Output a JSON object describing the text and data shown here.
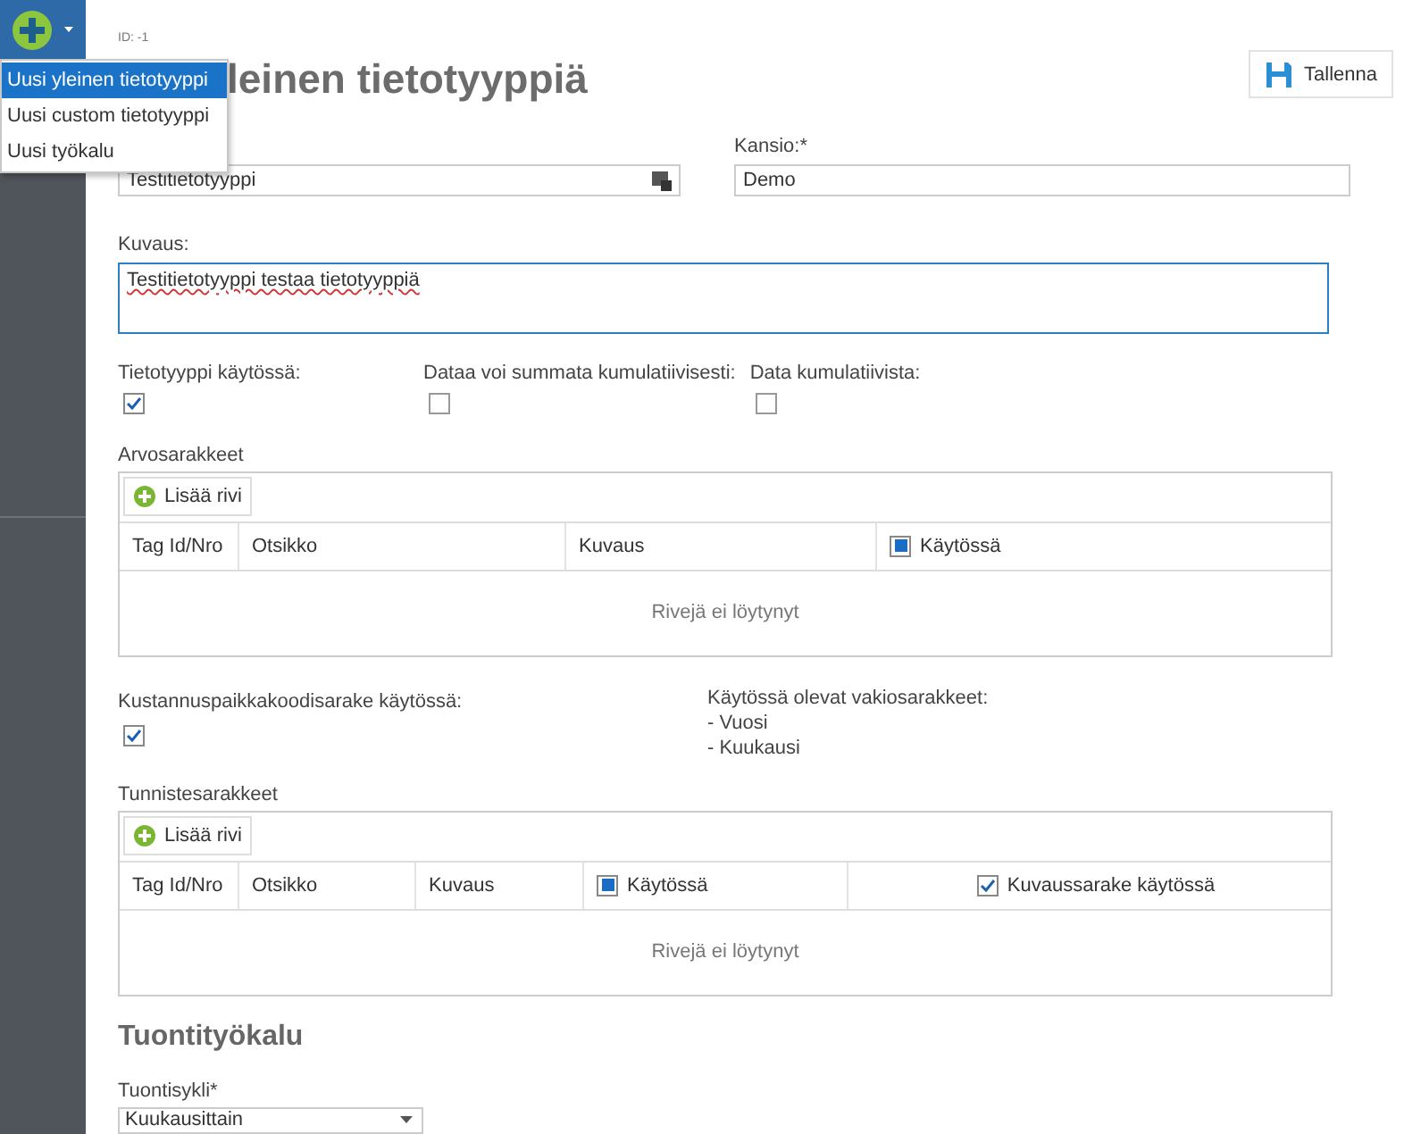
{
  "sidebar": {
    "menu": [
      {
        "label": "Uusi yleinen tietotyyppi",
        "selected": true
      },
      {
        "label": "Uusi custom tietotyyppi",
        "selected": false
      },
      {
        "label": "Uusi työkalu",
        "selected": false
      }
    ]
  },
  "header": {
    "id_text": "ID: -1",
    "title": "leinen tietotyyppiä",
    "save_button": "Tallenna"
  },
  "fields": {
    "name_value": "Testitietotyyppi",
    "folder_label": "Kansio:*",
    "folder_value": "Demo",
    "description_label": "Kuvaus:",
    "description_value": "Testitietotyyppi testaa tietotyyppiä"
  },
  "flags": [
    {
      "label": "Tietotyyppi käytössä:",
      "checked": true
    },
    {
      "label": "Dataa voi summata kumulatiivisesti:",
      "checked": false
    },
    {
      "label": "Data kumulatiivista:",
      "checked": false
    }
  ],
  "value_table": {
    "title": "Arvosarakkeet",
    "add_button": "Lisää rivi",
    "empty_text": "Rivejä ei löytynyt",
    "columns": [
      {
        "label": "Tag Id/Nro",
        "kind": "text"
      },
      {
        "label": "Otsikko",
        "kind": "text"
      },
      {
        "label": "Kuvaus",
        "kind": "text"
      },
      {
        "label": "Käytössä",
        "kind": "filled-checkbox",
        "checked": true
      }
    ]
  },
  "cost_center": {
    "label": "Kustannuspaikkakoodisarake käytössä:",
    "checked": true
  },
  "standard_columns": {
    "label": "Käytössä olevat vakiosarakkeet:",
    "items": [
      "- Vuosi",
      "- Kuukausi"
    ]
  },
  "id_table": {
    "title": "Tunnistesarakkeet",
    "add_button": "Lisää rivi",
    "empty_text": "Rivejä ei löytynyt",
    "columns": [
      {
        "label": "Tag Id/Nro",
        "kind": "text"
      },
      {
        "label": "Otsikko",
        "kind": "text"
      },
      {
        "label": "Kuvaus",
        "kind": "text"
      },
      {
        "label": "Käytössä",
        "kind": "filled-checkbox",
        "checked": true
      },
      {
        "label": "Kuvaussarake käytössä",
        "kind": "checkbox",
        "checked": true
      }
    ]
  },
  "import_tool": {
    "heading": "Tuontityökalu",
    "cycle_label": "Tuontisykli*",
    "cycle_value": "Kuukausittain"
  }
}
